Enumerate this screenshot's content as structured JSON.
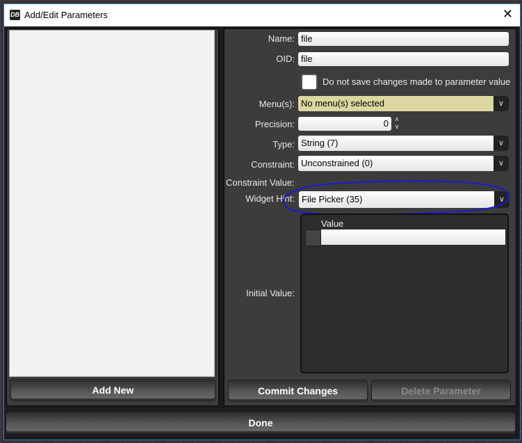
{
  "window": {
    "title": "Add/Edit Parameters",
    "logo": "DB"
  },
  "left": {
    "add_new": "Add New"
  },
  "form": {
    "name_label": "Name:",
    "name_value": "file",
    "oid_label": "OID:",
    "oid_value": "file",
    "no_save_label": "Do not save changes made to parameter value",
    "menus_label": "Menu(s):",
    "menus_value": "No menu(s) selected",
    "precision_label": "Precision:",
    "precision_value": "0",
    "type_label": "Type:",
    "type_value": "String (7)",
    "constraint_label": "Constraint:",
    "constraint_value": "Unconstrained (0)",
    "constraint_value_label": "Constraint Value:",
    "widget_hint_label": "Widget Hint:",
    "widget_hint_value": "File Picker (35)",
    "initial_value_label": "Initial Value:",
    "table_header": "Value"
  },
  "buttons": {
    "commit": "Commit Changes",
    "delete": "Delete Parameter",
    "done": "Done"
  },
  "colors": {
    "annotation": "#1a1ad6",
    "menus_bg": "#dcd7a0"
  }
}
